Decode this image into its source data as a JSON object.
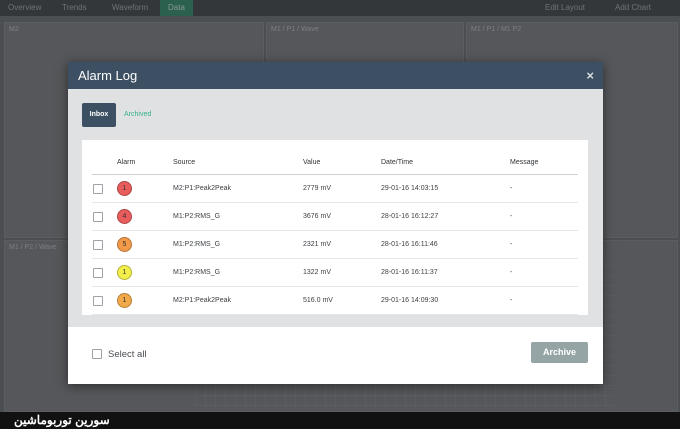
{
  "background": {
    "tabs": [
      "Overview",
      "Trends",
      "Waveform",
      "Data"
    ],
    "right_links": [
      "Edit Layout",
      "Add Chart"
    ],
    "panel_titles": [
      "M2",
      "M1 / P1 / Wave",
      "M1 / P1 / M1 P2",
      "M1 / P2 / Wave"
    ]
  },
  "modal": {
    "title": "Alarm Log",
    "close_glyph": "×",
    "tabs": {
      "inbox": "Inbox",
      "archived": "Archived"
    },
    "columns": [
      "Alarm",
      "Source",
      "Value",
      "Date/Time",
      "Message"
    ],
    "rows": [
      {
        "alarm": "1",
        "alarm_color": "#e85c5c",
        "source": "M2:P1:Peak2Peak",
        "value": "2779 mV",
        "datetime": "29-01-16 14:03:15",
        "message": "-"
      },
      {
        "alarm": "4",
        "alarm_color": "#e85c5c",
        "source": "M1:P2:RMS_G",
        "value": "3676 mV",
        "datetime": "28-01-16 16:12:27",
        "message": "-"
      },
      {
        "alarm": "5",
        "alarm_color": "#f29a4a",
        "source": "M1:P2:RMS_G",
        "value": "2321 mV",
        "datetime": "28-01-16 16:11:46",
        "message": "-"
      },
      {
        "alarm": "1",
        "alarm_color": "#f2ef4a",
        "source": "M1:P2:RMS_G",
        "value": "1322 mV",
        "datetime": "28-01-16 16:11:37",
        "message": "-"
      },
      {
        "alarm": "1",
        "alarm_color": "#f2a94a",
        "source": "M2:P1:Peak2Peak",
        "value": "516.0 mV",
        "datetime": "29-01-16 14:09:30",
        "message": "-"
      }
    ],
    "select_all_label": "Select all",
    "archive_label": "Archive"
  },
  "caption": "سورین توربوماشین"
}
